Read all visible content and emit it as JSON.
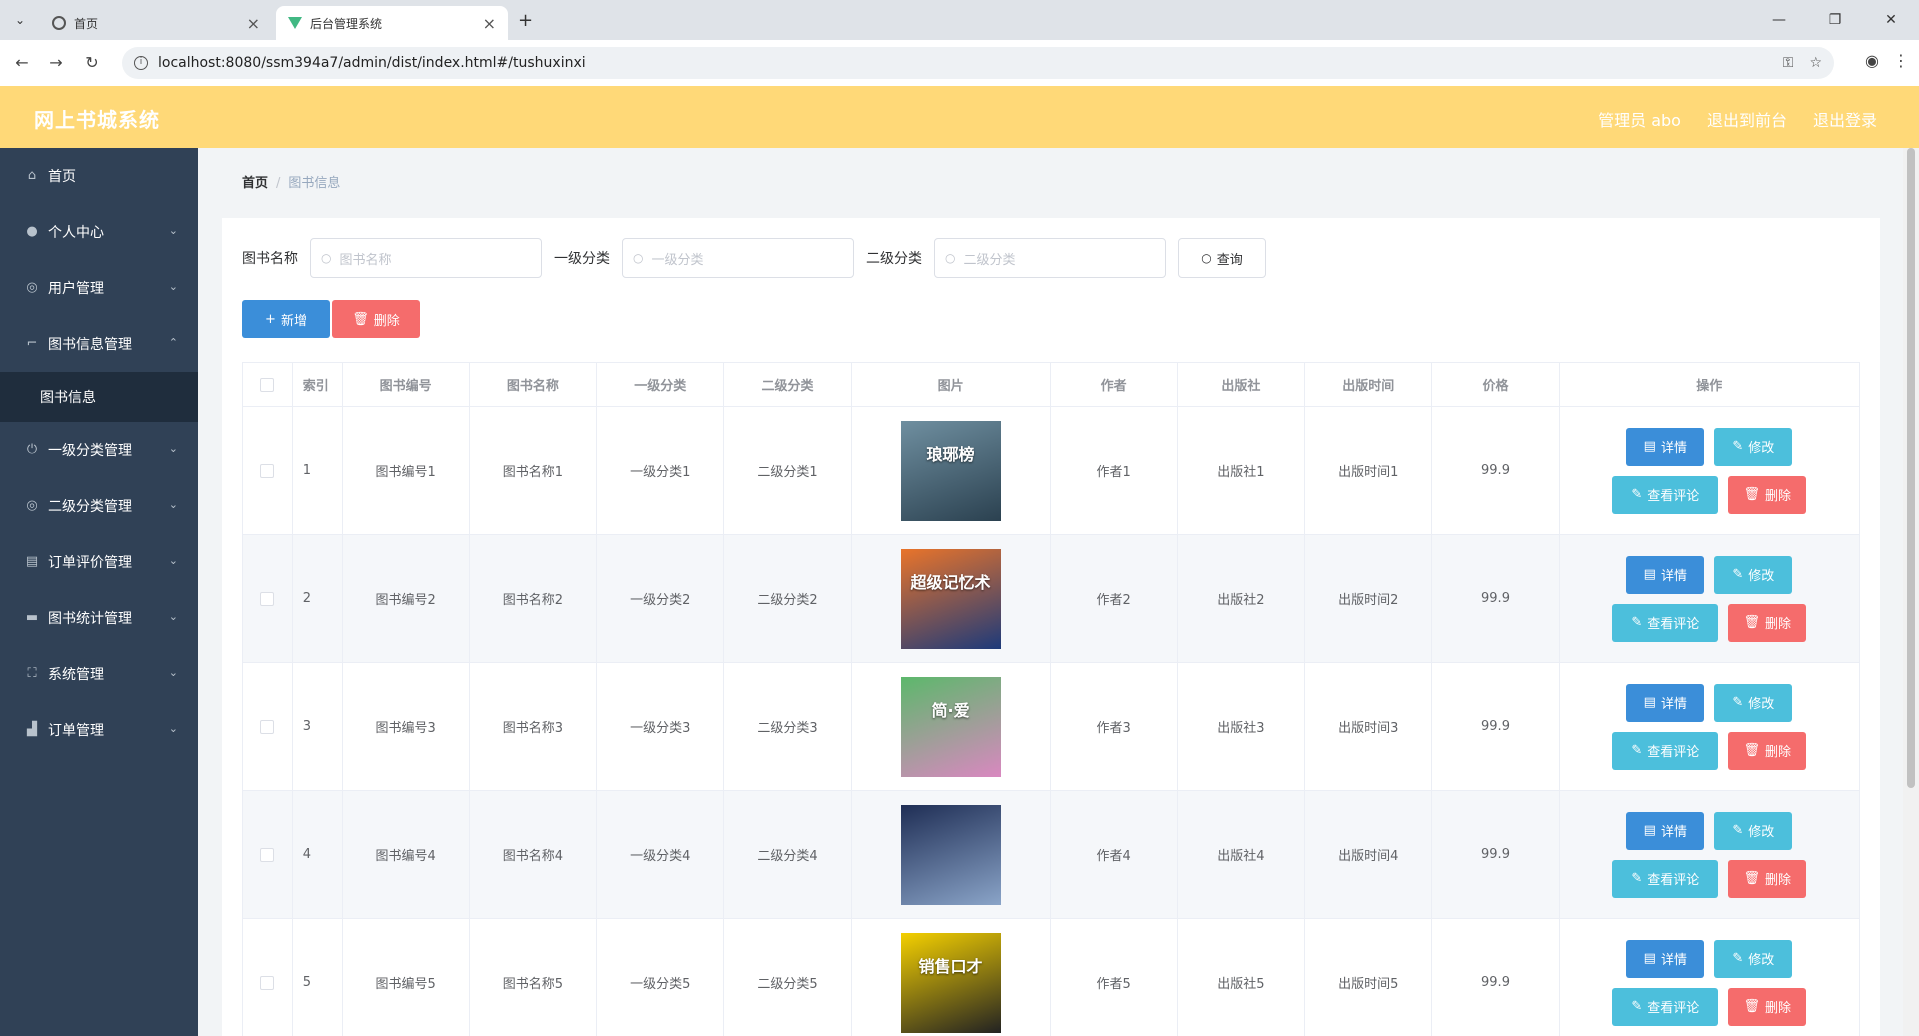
{
  "browser": {
    "tabs": [
      {
        "title": "首页",
        "icon": "globe-icon"
      },
      {
        "title": "后台管理系统",
        "icon": "vue-logo-icon"
      }
    ],
    "url": "localhost:8080/ssm394a7/admin/dist/index.html#/tushuxinxi"
  },
  "header": {
    "brand": "网上书城系统",
    "links": [
      "管理员 abo",
      "退出到前台",
      "退出登录"
    ],
    "color": "#ffd978"
  },
  "sidebar": {
    "items": [
      {
        "label": "首页",
        "icon": "home-icon"
      },
      {
        "label": "个人中心",
        "icon": "user-icon"
      },
      {
        "label": "用户管理",
        "icon": "compass-icon"
      },
      {
        "label": "图书信息管理",
        "icon": "crop-icon",
        "expanded": true,
        "children": [
          "图书信息"
        ]
      },
      {
        "label": "一级分类管理",
        "icon": "power-icon"
      },
      {
        "label": "二级分类管理",
        "icon": "compass-icon"
      },
      {
        "label": "订单评价管理",
        "icon": "document-icon"
      },
      {
        "label": "图书统计管理",
        "icon": "tickets-icon"
      },
      {
        "label": "系统管理",
        "icon": "fullscreen-icon"
      },
      {
        "label": "订单管理",
        "icon": "finance-icon"
      }
    ]
  },
  "breadcrumb": [
    "首页",
    "图书信息"
  ],
  "search": {
    "fields": [
      {
        "label": "图书名称",
        "placeholder": "图书名称"
      },
      {
        "label": "一级分类",
        "placeholder": "一级分类"
      },
      {
        "label": "二级分类",
        "placeholder": "二级分类"
      }
    ],
    "query_label": "查询"
  },
  "actions": {
    "add": "新增",
    "delete": "删除"
  },
  "table": {
    "headers": [
      "索引",
      "图书编号",
      "图书名称",
      "一级分类",
      "二级分类",
      "图片",
      "作者",
      "出版社",
      "出版时间",
      "价格",
      "操作"
    ],
    "rows": [
      {
        "idx": "1",
        "code": "图书编号1",
        "name": "图书名称1",
        "cat1": "一级分类1",
        "cat2": "二级分类1",
        "cover_text": "琅琊榜",
        "cover_colors": [
          "#6f8fa0",
          "#2b4150"
        ],
        "author": "作者1",
        "publisher": "出版社1",
        "time": "出版时间1",
        "price": "99.9"
      },
      {
        "idx": "2",
        "code": "图书编号2",
        "name": "图书名称2",
        "cat1": "一级分类2",
        "cat2": "二级分类2",
        "cover_text": "超级记忆术",
        "cover_colors": [
          "#e9742a",
          "#1d3a7a"
        ],
        "author": "作者2",
        "publisher": "出版社2",
        "time": "出版时间2",
        "price": "99.9"
      },
      {
        "idx": "3",
        "code": "图书编号3",
        "name": "图书名称3",
        "cat1": "一级分类3",
        "cat2": "二级分类3",
        "cover_text": "简·爱",
        "cover_colors": [
          "#5cb86b",
          "#d988c0"
        ],
        "author": "作者3",
        "publisher": "出版社3",
        "time": "出版时间3",
        "price": "99.9"
      },
      {
        "idx": "4",
        "code": "图书编号4",
        "name": "图书名称4",
        "cat1": "一级分类4",
        "cat2": "二级分类4",
        "cover_text": "",
        "cover_colors": [
          "#1f2e55",
          "#8aa4c8"
        ],
        "author": "作者4",
        "publisher": "出版社4",
        "time": "出版时间4",
        "price": "99.9"
      },
      {
        "idx": "5",
        "code": "图书编号5",
        "name": "图书名称5",
        "cat1": "一级分类5",
        "cat2": "二级分类5",
        "cover_text": "销售口才",
        "cover_colors": [
          "#f4d000",
          "#222222"
        ],
        "author": "作者5",
        "publisher": "出版社5",
        "time": "出版时间5",
        "price": "99.9"
      }
    ],
    "row_ops": {
      "detail": "详情",
      "edit": "修改",
      "review": "查看评论",
      "delete": "删除"
    }
  }
}
